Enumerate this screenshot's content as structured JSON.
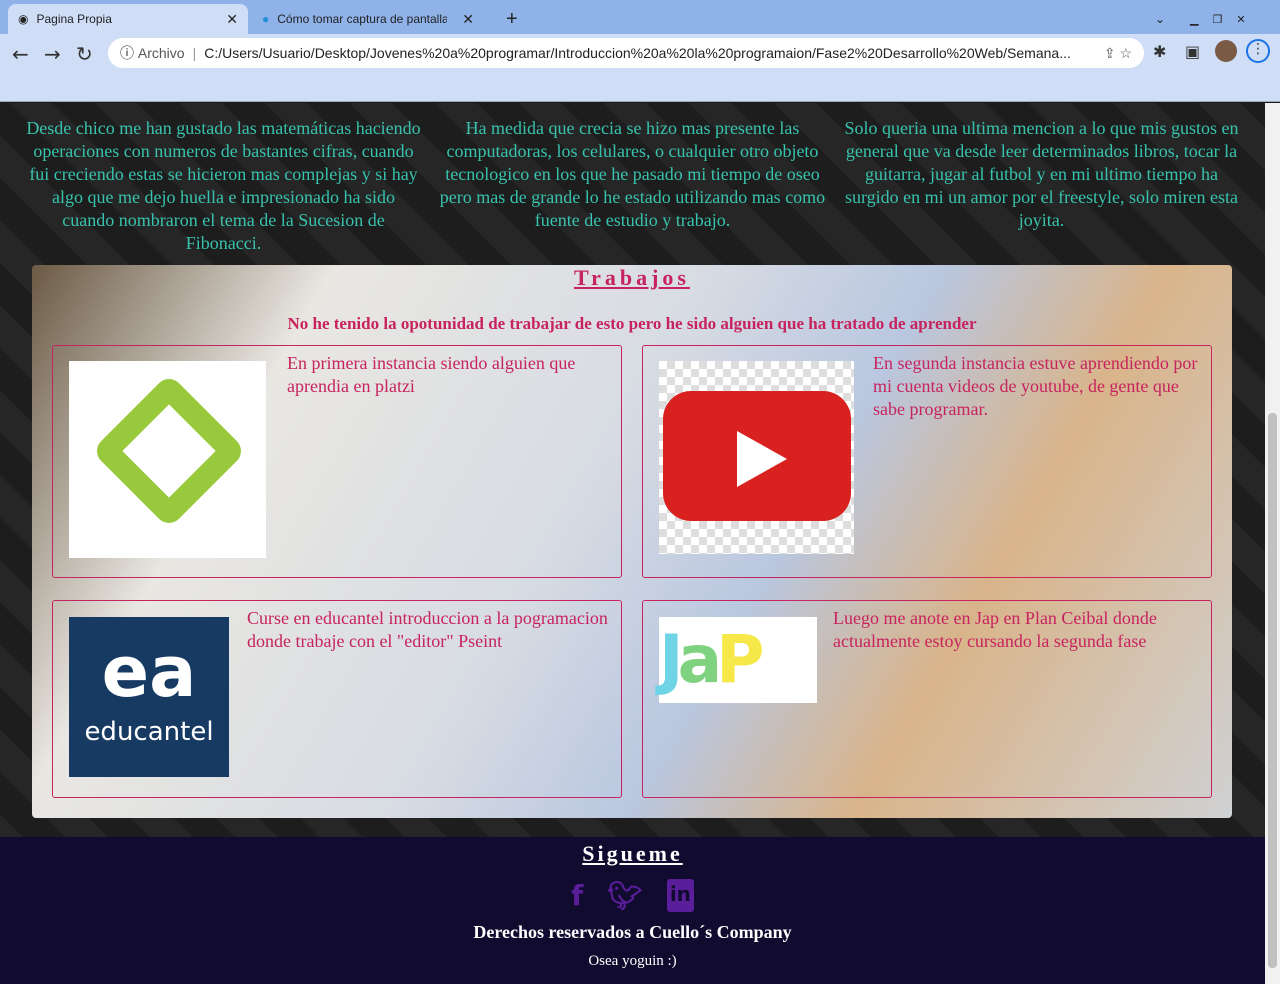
{
  "browser": {
    "tabs": [
      {
        "title": "Pagina Propia",
        "icon": "globe-icon"
      },
      {
        "title": "Cómo tomar captura de pantalla (Sc",
        "icon": "hp-icon"
      }
    ],
    "address_prefix": "Archivo",
    "url": "C:/Users/Usuario/Desktop/Jovenes%20a%20programar/Introduccion%20a%20la%20programaion/Fase2%20Desarrollo%20Web/Semana..."
  },
  "about": {
    "columns": [
      "Desde chico me han gustado las matemáticas haciendo operaciones con numeros de bastantes cifras, cuando fui creciendo estas se hicieron mas complejas y si hay algo que me dejo huella e impresionado ha sido cuando nombraron el tema de la Sucesion de Fibonacci.",
      "Ha medida que crecia se hizo mas presente las computadoras, los celulares, o cualquier otro objeto tecnologico en los que he pasado mi tiempo de oseo pero mas de grande lo he estado utilizando mas como fuente de estudio y trabajo.",
      "Solo queria una ultima mencion a lo que mis gustos en general que va desde leer determinados libros, tocar la guitarra, jugar al futbol y en mi ultimo tiempo ha surgido en mi un amor por el freestyle, solo miren esta joyita."
    ]
  },
  "trabajos": {
    "title": "Trabajos",
    "subtitle": "No he tenido la opotunidad de trabajar de esto pero he sido alguien que ha tratado de aprender",
    "cards": [
      {
        "text": "En primera instancia siendo alguien que aprendia en platzi",
        "logo": "platzi-logo"
      },
      {
        "text": "En segunda instancia estuve aprendiendo por mi cuenta videos de youtube, de gente que sabe programar.",
        "logo": "youtube-logo"
      },
      {
        "text": "Curse en educantel introduccion a la pogramacion donde trabaje con el \"editor\" Pseint",
        "logo": "educantel-logo",
        "logo_text": "educantel"
      },
      {
        "text": "Luego me anote en Jap en Plan Ceibal donde actualmente estoy cursando la segunda fase",
        "logo": "jap-logo"
      }
    ]
  },
  "footer": {
    "title": "Sigueme",
    "social": [
      "facebook-icon",
      "twitter-icon",
      "linkedin-icon"
    ],
    "copyright": "Derechos reservados a Cuello´s Company",
    "tagline": "Osea yoguin :)"
  },
  "colors": {
    "accent": "#c7235e",
    "about_text": "#37c3ad",
    "footer_bg": "#110b30",
    "social": "#5a1e9a"
  }
}
